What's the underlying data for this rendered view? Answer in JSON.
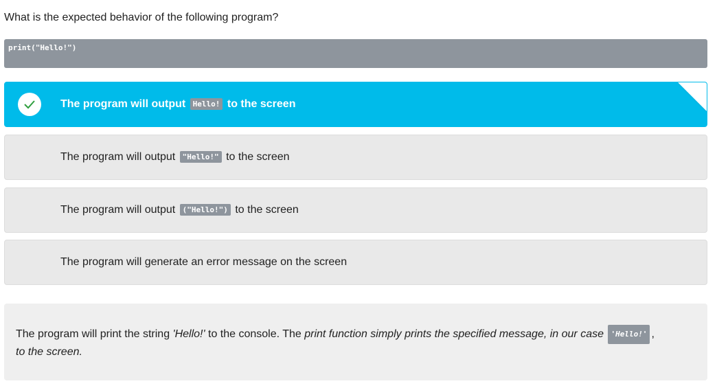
{
  "question": {
    "text": "What is the expected behavior of the following program?"
  },
  "code": {
    "text": "print(\"Hello!\")"
  },
  "options": [
    {
      "before": "The program will output",
      "code": "Hello!",
      "after": "to the screen",
      "selected": true,
      "correct": true
    },
    {
      "before": "The program will output",
      "code": "\"Hello!\"",
      "after": "to the screen",
      "selected": false
    },
    {
      "before": "The program will output",
      "code": "(\"Hello!\")",
      "after": "to the screen",
      "selected": false
    },
    {
      "text": "The program will generate an error message on the screen",
      "selected": false
    }
  ],
  "explanation": {
    "part1": "The program will print the string ",
    "string_literal": "'Hello!'",
    "part2": " to the console. The ",
    "part3": "print function simply prints the specified message, in our case",
    "code": "'Hello!'",
    "part4": ",",
    "part5": "to the screen."
  },
  "colors": {
    "selected": "#00bbea",
    "code_bg": "#8e959d",
    "option_bg": "#e9e9e9",
    "check": "#2e9e3e"
  },
  "icons": {
    "check": "check-icon",
    "corner": "corner-fold-icon"
  }
}
